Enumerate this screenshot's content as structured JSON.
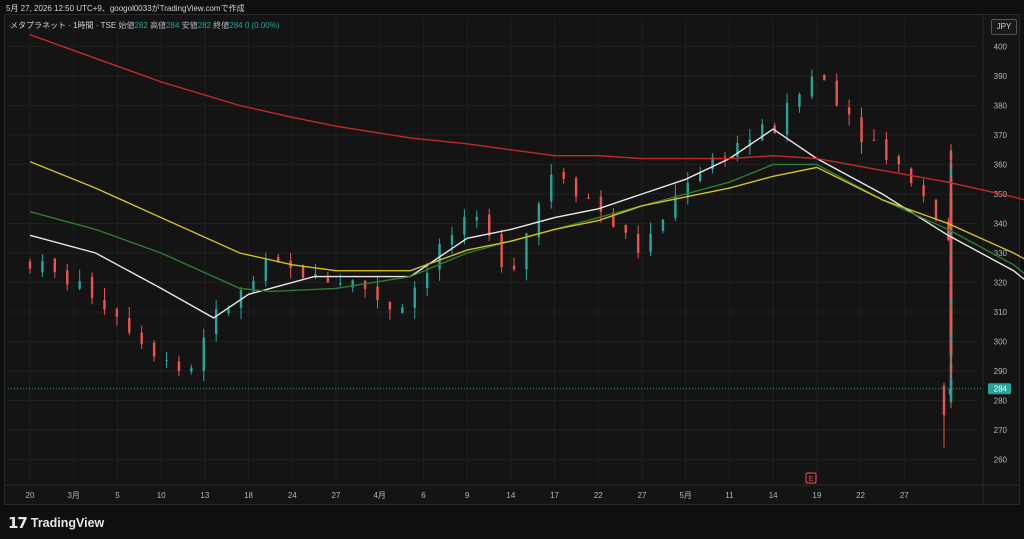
{
  "header": {
    "topline": "5月 27, 2026 12:50 UTC+9、googol0033がTradingView.comで作成"
  },
  "legend": {
    "symbol": "メタプラネット · 1時間 · TSE",
    "open_label": "始値",
    "open_value": "282",
    "high_label": "高値",
    "high_value": "284",
    "low_label": "安値",
    "low_value": "282",
    "close_label": "終値",
    "close_value": "284",
    "change": "0 (0.00%)"
  },
  "currency_button": "JPY",
  "footer": {
    "brand": "TradingView",
    "logo_mark": "17"
  },
  "colors": {
    "up": "#26a69a",
    "down": "#ef5350",
    "ma_white": "#e8e8e8",
    "ma_green": "#2e7d32",
    "ma_yellow": "#d4c21a",
    "ma_red": "#c62828",
    "price_tag": "#26a69a"
  },
  "chart_data": {
    "type": "candlestick",
    "y_axis_labels": [
      "400",
      "390",
      "380",
      "370",
      "360",
      "350",
      "340",
      "330",
      "320",
      "310",
      "300",
      "290",
      "280",
      "270",
      "260"
    ],
    "ylim": [
      257,
      404
    ],
    "x_axis_labels": [
      "20",
      "3月",
      "5",
      "10",
      "13",
      "18",
      "24",
      "27",
      "4月",
      "6",
      "9",
      "14",
      "17",
      "22",
      "27",
      "5月",
      "11",
      "14",
      "19",
      "22",
      "27"
    ],
    "last_price": "284",
    "event_marker": "E",
    "close_path": [
      [
        0,
        327
      ],
      [
        1.5,
        316
      ],
      [
        2.5,
        302
      ],
      [
        3.6,
        288
      ],
      [
        4,
        304
      ],
      [
        5.5,
        326
      ],
      [
        6.5,
        322
      ],
      [
        7.5,
        320
      ],
      [
        8.4,
        310
      ],
      [
        9.5,
        335
      ],
      [
        10.2,
        340
      ],
      [
        11,
        325
      ],
      [
        12,
        360
      ],
      [
        13,
        345
      ],
      [
        14,
        330
      ],
      [
        15,
        355
      ],
      [
        16,
        366
      ],
      [
        17,
        372
      ],
      [
        18,
        392
      ],
      [
        19,
        372
      ],
      [
        20.2,
        355
      ],
      [
        21,
        336
      ],
      [
        22.3,
        322
      ],
      [
        23,
        310
      ],
      [
        24.5,
        312
      ],
      [
        25.6,
        316
      ],
      [
        26.3,
        308
      ],
      [
        27,
        300
      ],
      [
        28,
        296
      ],
      [
        29,
        302
      ],
      [
        30,
        300
      ],
      [
        31.3,
        304
      ],
      [
        32,
        299
      ],
      [
        33,
        304
      ],
      [
        34,
        318
      ],
      [
        35,
        310
      ],
      [
        36,
        318
      ],
      [
        37.5,
        308
      ],
      [
        38,
        322
      ],
      [
        39,
        333
      ],
      [
        40,
        345
      ],
      [
        41,
        338
      ],
      [
        42,
        336
      ],
      [
        42.8,
        330
      ],
      [
        43.5,
        340
      ],
      [
        44.5,
        345
      ],
      [
        45,
        350
      ],
      [
        46,
        342
      ],
      [
        47,
        332
      ],
      [
        48,
        321
      ],
      [
        49,
        314
      ],
      [
        50,
        330
      ],
      [
        51,
        370
      ],
      [
        52,
        355
      ],
      [
        53,
        352
      ],
      [
        53.8,
        338
      ],
      [
        55,
        335
      ],
      [
        56,
        325
      ],
      [
        57,
        314
      ],
      [
        58,
        322
      ],
      [
        59,
        310
      ],
      [
        60,
        305
      ],
      [
        61,
        308
      ],
      [
        62,
        312
      ],
      [
        62.9,
        300
      ],
      [
        63.8,
        292
      ],
      [
        64.8,
        281
      ],
      [
        65.3,
        284
      ]
    ],
    "moving_averages": [
      {
        "color_key": "ma_white",
        "points": [
          [
            0,
            336
          ],
          [
            1.5,
            330
          ],
          [
            3,
            318
          ],
          [
            4.2,
            308
          ],
          [
            5,
            316
          ],
          [
            6.5,
            322
          ],
          [
            7.5,
            322
          ],
          [
            8.7,
            322
          ],
          [
            10,
            335
          ],
          [
            11,
            338
          ],
          [
            12,
            342
          ],
          [
            13,
            345
          ],
          [
            14,
            350
          ],
          [
            15,
            355
          ],
          [
            16,
            362
          ],
          [
            17,
            372
          ],
          [
            18,
            362
          ],
          [
            19.5,
            350
          ],
          [
            21,
            336
          ],
          [
            22.5,
            324
          ],
          [
            23,
            318
          ],
          [
            24.5,
            314
          ],
          [
            26,
            312
          ],
          [
            27,
            306
          ],
          [
            29.5,
            301
          ],
          [
            31,
            302
          ],
          [
            32,
            303
          ],
          [
            33,
            307
          ],
          [
            34,
            308
          ],
          [
            35,
            310
          ],
          [
            36,
            311
          ],
          [
            37.5,
            313
          ],
          [
            38,
            318
          ],
          [
            39,
            326
          ],
          [
            40,
            333
          ],
          [
            41,
            338
          ],
          [
            42,
            338
          ],
          [
            42.8,
            338
          ],
          [
            43.5,
            340
          ],
          [
            44.5,
            345
          ],
          [
            45,
            347
          ],
          [
            46,
            344
          ],
          [
            47,
            336
          ],
          [
            48,
            326
          ],
          [
            49,
            320
          ],
          [
            50,
            327
          ],
          [
            51,
            345
          ],
          [
            52,
            350
          ],
          [
            53,
            348
          ],
          [
            53.8,
            343
          ],
          [
            55,
            338
          ],
          [
            56,
            332
          ],
          [
            57,
            324
          ],
          [
            58,
            318
          ],
          [
            59,
            314
          ],
          [
            60,
            312
          ],
          [
            61,
            314
          ],
          [
            62,
            316
          ],
          [
            63.2,
            308
          ],
          [
            64.2,
            299
          ]
        ]
      },
      {
        "color_key": "ma_green",
        "points": [
          [
            0,
            344
          ],
          [
            1.5,
            338
          ],
          [
            3,
            330
          ],
          [
            4.8,
            318
          ],
          [
            5.5,
            317
          ],
          [
            7,
            318
          ],
          [
            8.7,
            322
          ],
          [
            10,
            330
          ],
          [
            11,
            334
          ],
          [
            12,
            338
          ],
          [
            13,
            342
          ],
          [
            14,
            346
          ],
          [
            15,
            350
          ],
          [
            16,
            354
          ],
          [
            17,
            360
          ],
          [
            18,
            360
          ],
          [
            19.5,
            348
          ],
          [
            21,
            338
          ],
          [
            22.5,
            326
          ],
          [
            23,
            320
          ],
          [
            24.5,
            316
          ],
          [
            26,
            313
          ],
          [
            27,
            309
          ],
          [
            29.5,
            306
          ],
          [
            31,
            305
          ],
          [
            32,
            305
          ],
          [
            33,
            307
          ],
          [
            34,
            308
          ],
          [
            35,
            309
          ],
          [
            36,
            310
          ],
          [
            37.5,
            312
          ],
          [
            38,
            315
          ],
          [
            39,
            321
          ],
          [
            40,
            327
          ],
          [
            41,
            331
          ],
          [
            42,
            333
          ],
          [
            42.8,
            334
          ],
          [
            43.5,
            335
          ],
          [
            44.5,
            338
          ],
          [
            45,
            339
          ],
          [
            46,
            338
          ],
          [
            47,
            334
          ],
          [
            48,
            330
          ],
          [
            49,
            327
          ],
          [
            50,
            331
          ],
          [
            51,
            340
          ],
          [
            52,
            344
          ],
          [
            53,
            344
          ],
          [
            53.8,
            342
          ],
          [
            55,
            338
          ],
          [
            56,
            334
          ],
          [
            57,
            328
          ],
          [
            58,
            322
          ],
          [
            59,
            318
          ],
          [
            60,
            317
          ],
          [
            61,
            318
          ],
          [
            62,
            319
          ],
          [
            63.2,
            313
          ],
          [
            64.2,
            305
          ]
        ]
      },
      {
        "color_key": "ma_yellow",
        "points": [
          [
            0,
            361
          ],
          [
            1.5,
            352
          ],
          [
            3,
            342
          ],
          [
            4.8,
            330
          ],
          [
            6,
            326
          ],
          [
            7,
            324
          ],
          [
            8.7,
            324
          ],
          [
            10,
            331
          ],
          [
            11,
            334
          ],
          [
            12,
            338
          ],
          [
            13,
            341
          ],
          [
            14,
            346
          ],
          [
            15,
            349
          ],
          [
            16,
            352
          ],
          [
            17,
            356
          ],
          [
            18,
            359
          ],
          [
            19.5,
            348
          ],
          [
            21,
            340
          ],
          [
            22.5,
            330
          ],
          [
            23,
            326
          ],
          [
            24.5,
            320
          ],
          [
            26,
            316
          ],
          [
            27,
            313
          ],
          [
            29.5,
            310
          ],
          [
            31,
            309
          ],
          [
            32,
            309
          ],
          [
            33,
            309
          ],
          [
            34,
            310
          ],
          [
            35,
            310
          ],
          [
            36,
            311
          ],
          [
            37.5,
            312
          ],
          [
            38,
            314
          ],
          [
            39,
            319
          ],
          [
            40,
            325
          ],
          [
            41,
            328
          ],
          [
            42,
            330
          ],
          [
            42.8,
            330
          ],
          [
            43.5,
            331
          ],
          [
            44.5,
            334
          ],
          [
            45,
            335
          ],
          [
            46,
            335
          ],
          [
            47,
            333
          ],
          [
            48,
            331
          ],
          [
            49,
            330
          ],
          [
            50,
            333
          ],
          [
            51,
            339
          ],
          [
            52,
            342
          ],
          [
            53,
            342
          ],
          [
            53.8,
            341
          ],
          [
            55,
            339
          ],
          [
            56,
            336
          ],
          [
            57,
            331
          ],
          [
            58,
            327
          ],
          [
            59,
            323
          ],
          [
            60,
            321
          ],
          [
            61,
            322
          ],
          [
            62,
            321
          ],
          [
            63.2,
            317
          ],
          [
            64.2,
            310
          ]
        ]
      },
      {
        "color_key": "ma_red",
        "points": [
          [
            0,
            404
          ],
          [
            1.5,
            396
          ],
          [
            3,
            388
          ],
          [
            4.8,
            380
          ],
          [
            6,
            376
          ],
          [
            7,
            373
          ],
          [
            8.7,
            369
          ],
          [
            10,
            367
          ],
          [
            11,
            365
          ],
          [
            12,
            363
          ],
          [
            13,
            363
          ],
          [
            14,
            362
          ],
          [
            15,
            362
          ],
          [
            16,
            362
          ],
          [
            17,
            363
          ],
          [
            18,
            362
          ],
          [
            19.5,
            358
          ],
          [
            21,
            354
          ],
          [
            22.5,
            349
          ],
          [
            23,
            347
          ],
          [
            24.5,
            343
          ],
          [
            26,
            339
          ],
          [
            27,
            336
          ],
          [
            29.5,
            333
          ],
          [
            31,
            331
          ],
          [
            32,
            330
          ],
          [
            33,
            328
          ],
          [
            34,
            326
          ],
          [
            35,
            325
          ],
          [
            36,
            324
          ],
          [
            37.5,
            324
          ],
          [
            38,
            325
          ],
          [
            39,
            326
          ],
          [
            40,
            328
          ],
          [
            41,
            329
          ],
          [
            42,
            330
          ],
          [
            42.8,
            331
          ],
          [
            43.5,
            332
          ],
          [
            44.5,
            333
          ],
          [
            45,
            334
          ],
          [
            46,
            334
          ],
          [
            47,
            334
          ],
          [
            48,
            334
          ],
          [
            49,
            333
          ],
          [
            50,
            334
          ],
          [
            51,
            335
          ],
          [
            52,
            336
          ],
          [
            53,
            336
          ],
          [
            53.8,
            335
          ],
          [
            55,
            333
          ],
          [
            56,
            333
          ],
          [
            57,
            332
          ],
          [
            58,
            331
          ],
          [
            59,
            330
          ],
          [
            60,
            329
          ],
          [
            61,
            328
          ],
          [
            62,
            327
          ],
          [
            63.2,
            323
          ],
          [
            64.2,
            321
          ]
        ]
      }
    ]
  }
}
